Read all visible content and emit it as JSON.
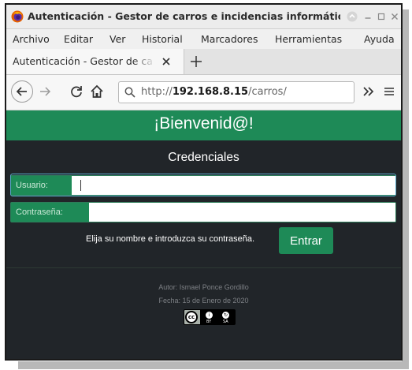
{
  "window": {
    "title": "Autenticación - Gestor de carros e incidencias informáticas"
  },
  "menubar": {
    "items": [
      "Archivo",
      "Editar",
      "Ver",
      "Historial",
      "Marcadores",
      "Herramientas",
      "Ayuda"
    ]
  },
  "tab": {
    "label": "Autenticación - Gestor de ca"
  },
  "url": {
    "scheme": "http://",
    "host": "192.168.8.15",
    "path": "/carros/"
  },
  "page": {
    "heading": "¡Bienvenid@!",
    "section_title": "Credenciales",
    "username_label": "Usuario:",
    "username_value": "",
    "password_label": "Contraseña:",
    "password_value": "",
    "hint": "Elija su nombre e introduzca su contraseña.",
    "submit_label": "Entrar",
    "footer_author": "Autor: Ismael Ponce Gordillo",
    "footer_date": "Fecha: 15 de Enero de 2020",
    "license": {
      "cc": "cc",
      "by": "BY",
      "sa": "SA"
    }
  },
  "colors": {
    "accent_green": "#1e8a57",
    "page_background": "#212529"
  },
  "icons": {
    "app": "firefox-icon",
    "back": "arrow-left-icon",
    "forward": "arrow-right-icon",
    "reload": "reload-icon",
    "home": "home-icon",
    "lock": "search-icon",
    "overflow": "chevron-double-right-icon",
    "menu": "hamburger-menu-icon"
  }
}
